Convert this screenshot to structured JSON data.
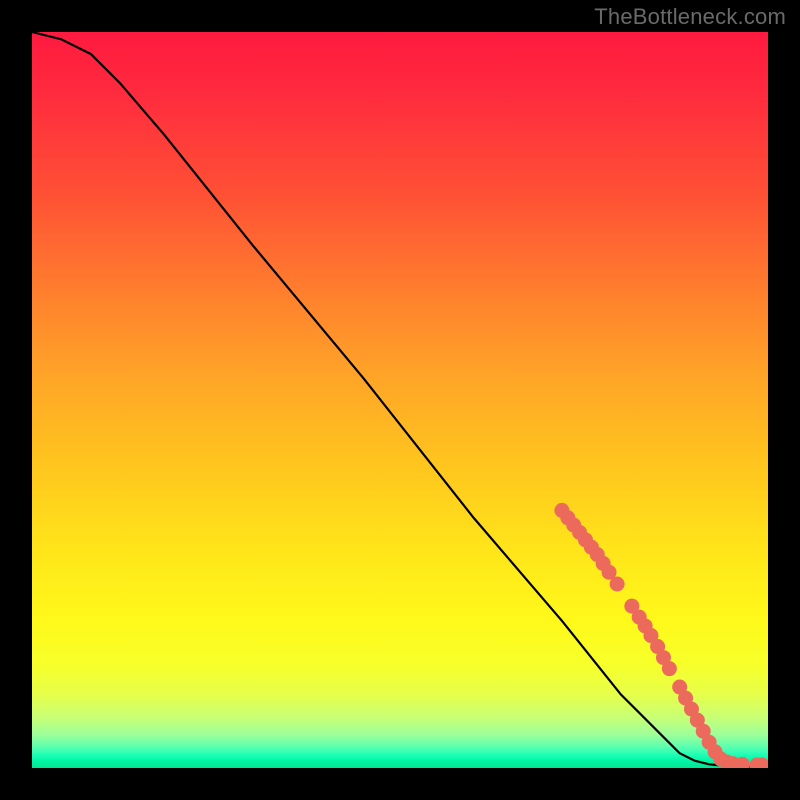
{
  "watermark": "TheBottleneck.com",
  "chart_data": {
    "type": "line",
    "title": "",
    "xlabel": "",
    "ylabel": "",
    "xlim": [
      0,
      100
    ],
    "ylim": [
      0,
      100
    ],
    "series": [
      {
        "name": "curve",
        "x": [
          0,
          4,
          8,
          12,
          18,
          30,
          45,
          60,
          72,
          80,
          85,
          88,
          90,
          92,
          95,
          100
        ],
        "y": [
          100,
          99,
          97,
          93,
          86,
          71,
          53,
          34,
          20,
          10,
          5,
          2,
          1,
          0.5,
          0.2,
          0.2
        ]
      }
    ],
    "markers": {
      "name": "highlighted-points",
      "color": "#ec6a5c",
      "points": [
        {
          "x": 72.0,
          "y": 35.0
        },
        {
          "x": 72.8,
          "y": 34.0
        },
        {
          "x": 73.6,
          "y": 33.0
        },
        {
          "x": 74.4,
          "y": 32.0
        },
        {
          "x": 75.2,
          "y": 31.0
        },
        {
          "x": 76.0,
          "y": 30.0
        },
        {
          "x": 76.8,
          "y": 29.0
        },
        {
          "x": 77.6,
          "y": 27.8
        },
        {
          "x": 78.4,
          "y": 26.6
        },
        {
          "x": 79.5,
          "y": 25.0
        },
        {
          "x": 81.5,
          "y": 22.0
        },
        {
          "x": 82.5,
          "y": 20.5
        },
        {
          "x": 83.3,
          "y": 19.3
        },
        {
          "x": 84.1,
          "y": 18.0
        },
        {
          "x": 85.0,
          "y": 16.5
        },
        {
          "x": 85.8,
          "y": 15.0
        },
        {
          "x": 86.6,
          "y": 13.5
        },
        {
          "x": 88.0,
          "y": 11.0
        },
        {
          "x": 88.8,
          "y": 9.5
        },
        {
          "x": 89.6,
          "y": 8.0
        },
        {
          "x": 90.4,
          "y": 6.5
        },
        {
          "x": 91.2,
          "y": 5.0
        },
        {
          "x": 92.0,
          "y": 3.5
        },
        {
          "x": 92.8,
          "y": 2.2
        },
        {
          "x": 93.6,
          "y": 1.2
        },
        {
          "x": 94.4,
          "y": 0.8
        },
        {
          "x": 95.2,
          "y": 0.6
        },
        {
          "x": 96.5,
          "y": 0.5
        },
        {
          "x": 98.5,
          "y": 0.4
        },
        {
          "x": 99.2,
          "y": 0.4
        },
        {
          "x": 101.5,
          "y": 0.4
        },
        {
          "x": 102.2,
          "y": 0.4
        }
      ]
    }
  }
}
